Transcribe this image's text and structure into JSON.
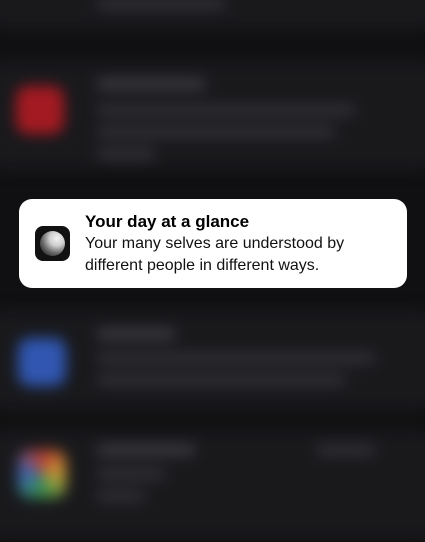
{
  "notification": {
    "title": "Your day at a glance",
    "body": "Your many selves are understood by different people in different ways.",
    "icon": "moon-app-icon"
  },
  "background_icons": [
    "red-app-icon",
    "blue-app-icon",
    "multicolor-app-icon"
  ]
}
